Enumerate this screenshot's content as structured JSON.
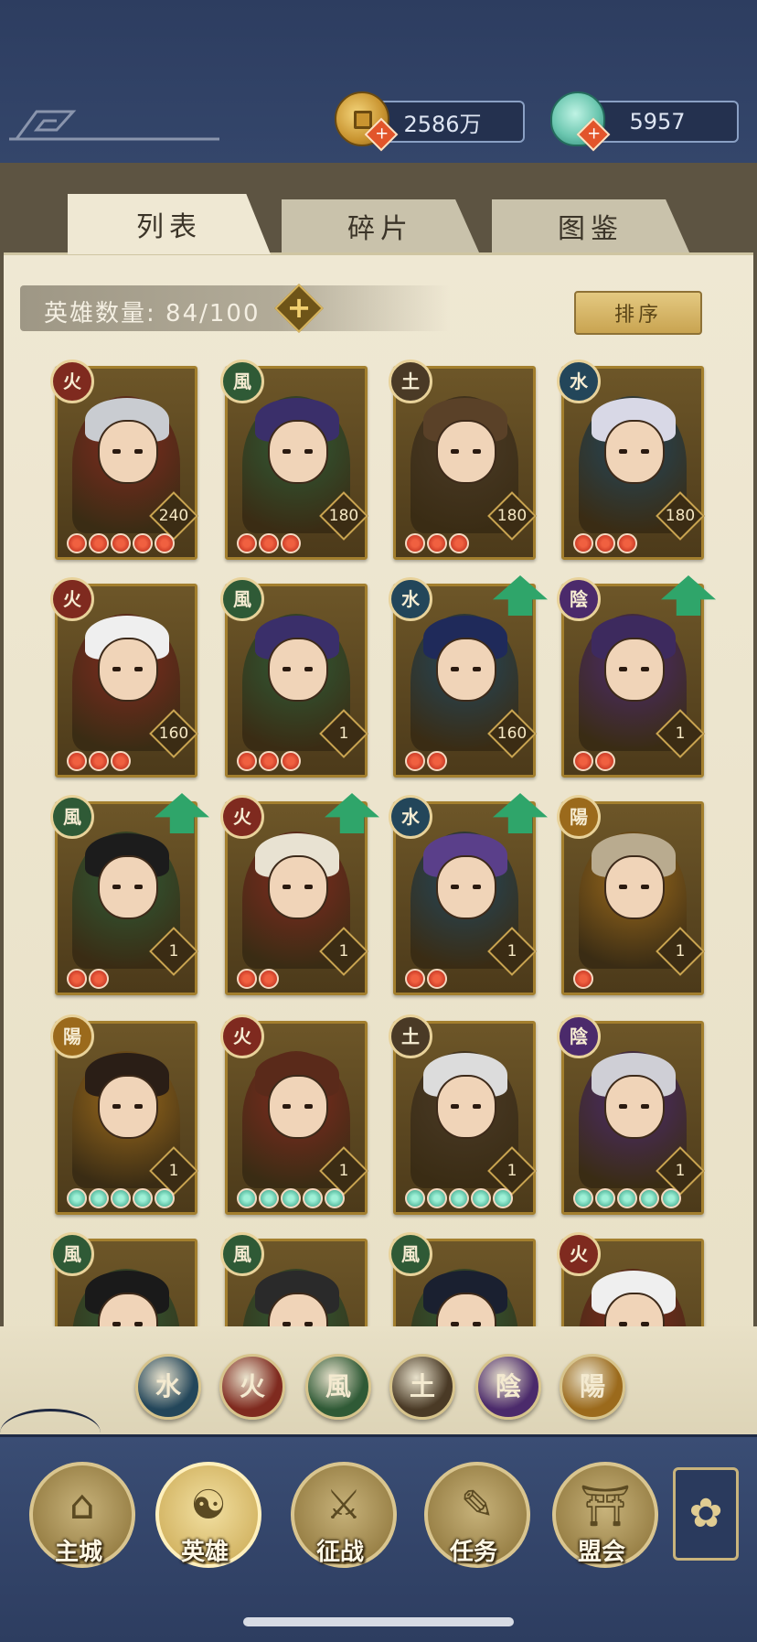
{
  "currency": {
    "gold": "2586万",
    "jade": "5957"
  },
  "tabs": [
    "列表",
    "碎片",
    "图鉴"
  ],
  "hero_count_label": "英雄数量: 84/100",
  "sort_label": "排序",
  "colors": {
    "fire": "#7f2a1f",
    "wind": "#2f5a36",
    "earth": "#4a3a26",
    "water": "#23465a",
    "yin": "#4b2a6b",
    "yang": "#9b6a1c"
  },
  "heroes": [
    {
      "element": "fire",
      "glyph": "火",
      "level": "240",
      "stars": 5,
      "star_type": "red",
      "upgrade": false,
      "hair": "#c9ccd1"
    },
    {
      "element": "wind",
      "glyph": "風",
      "level": "180",
      "stars": 3,
      "star_type": "red",
      "upgrade": false,
      "hair": "#3a2f6a"
    },
    {
      "element": "earth",
      "glyph": "土",
      "level": "180",
      "stars": 3,
      "star_type": "red",
      "upgrade": false,
      "hair": "#5a4128"
    },
    {
      "element": "water",
      "glyph": "水",
      "level": "180",
      "stars": 3,
      "star_type": "red",
      "upgrade": false,
      "hair": "#d8d8e6"
    },
    {
      "element": "fire",
      "glyph": "火",
      "level": "160",
      "stars": 3,
      "star_type": "red",
      "upgrade": false,
      "hair": "#efefef"
    },
    {
      "element": "wind",
      "glyph": "風",
      "level": "1",
      "stars": 3,
      "star_type": "red",
      "upgrade": false,
      "hair": "#3a2f6a"
    },
    {
      "element": "water",
      "glyph": "水",
      "level": "160",
      "stars": 2,
      "star_type": "red",
      "upgrade": true,
      "hair": "#1f2a5a"
    },
    {
      "element": "yin",
      "glyph": "陰",
      "level": "1",
      "stars": 2,
      "star_type": "red",
      "upgrade": true,
      "hair": "#3d2a5e"
    },
    {
      "element": "wind",
      "glyph": "風",
      "level": "1",
      "stars": 2,
      "star_type": "red",
      "upgrade": true,
      "hair": "#1c1c1c"
    },
    {
      "element": "fire",
      "glyph": "火",
      "level": "1",
      "stars": 2,
      "star_type": "red",
      "upgrade": true,
      "hair": "#e8e2d2"
    },
    {
      "element": "water",
      "glyph": "水",
      "level": "1",
      "stars": 2,
      "star_type": "red",
      "upgrade": true,
      "hair": "#5a3f8a"
    },
    {
      "element": "yang",
      "glyph": "陽",
      "level": "1",
      "stars": 1,
      "star_type": "red",
      "upgrade": false,
      "hair": "#b9ab8f"
    },
    {
      "element": "yang",
      "glyph": "陽",
      "level": "1",
      "stars": 5,
      "star_type": "jade",
      "upgrade": false,
      "hair": "#2a1e16"
    },
    {
      "element": "fire",
      "glyph": "火",
      "level": "1",
      "stars": 5,
      "star_type": "jade",
      "upgrade": false,
      "hair": "#5a2a1a"
    },
    {
      "element": "earth",
      "glyph": "土",
      "level": "1",
      "stars": 5,
      "star_type": "jade",
      "upgrade": false,
      "hair": "#dcdcdc"
    },
    {
      "element": "yin",
      "glyph": "陰",
      "level": "1",
      "stars": 5,
      "star_type": "jade",
      "upgrade": false,
      "hair": "#cfcfd6"
    },
    {
      "element": "wind",
      "glyph": "風",
      "level": "",
      "stars": 0,
      "star_type": "red",
      "upgrade": false,
      "hair": "#1a1a1a"
    },
    {
      "element": "wind",
      "glyph": "風",
      "level": "",
      "stars": 0,
      "star_type": "red",
      "upgrade": false,
      "hair": "#2a2a2a"
    },
    {
      "element": "wind",
      "glyph": "風",
      "level": "",
      "stars": 0,
      "star_type": "red",
      "upgrade": false,
      "hair": "#1a2030"
    },
    {
      "element": "fire",
      "glyph": "火",
      "level": "",
      "stars": 0,
      "star_type": "red",
      "upgrade": false,
      "hair": "#efefef"
    }
  ],
  "filters": [
    {
      "element": "water",
      "glyph": "水"
    },
    {
      "element": "fire",
      "glyph": "火"
    },
    {
      "element": "wind",
      "glyph": "風"
    },
    {
      "element": "earth",
      "glyph": "土"
    },
    {
      "element": "yin",
      "glyph": "陰"
    },
    {
      "element": "yang",
      "glyph": "陽"
    }
  ],
  "nav": [
    {
      "label": "主城",
      "glyph": "⌂",
      "active": false
    },
    {
      "label": "英雄",
      "glyph": "☯",
      "active": true
    },
    {
      "label": "征战",
      "glyph": "⚔",
      "active": false
    },
    {
      "label": "任务",
      "glyph": "✎",
      "active": false
    },
    {
      "label": "盟会",
      "glyph": "⛩",
      "active": false
    }
  ],
  "nav_more_glyph": "✿"
}
